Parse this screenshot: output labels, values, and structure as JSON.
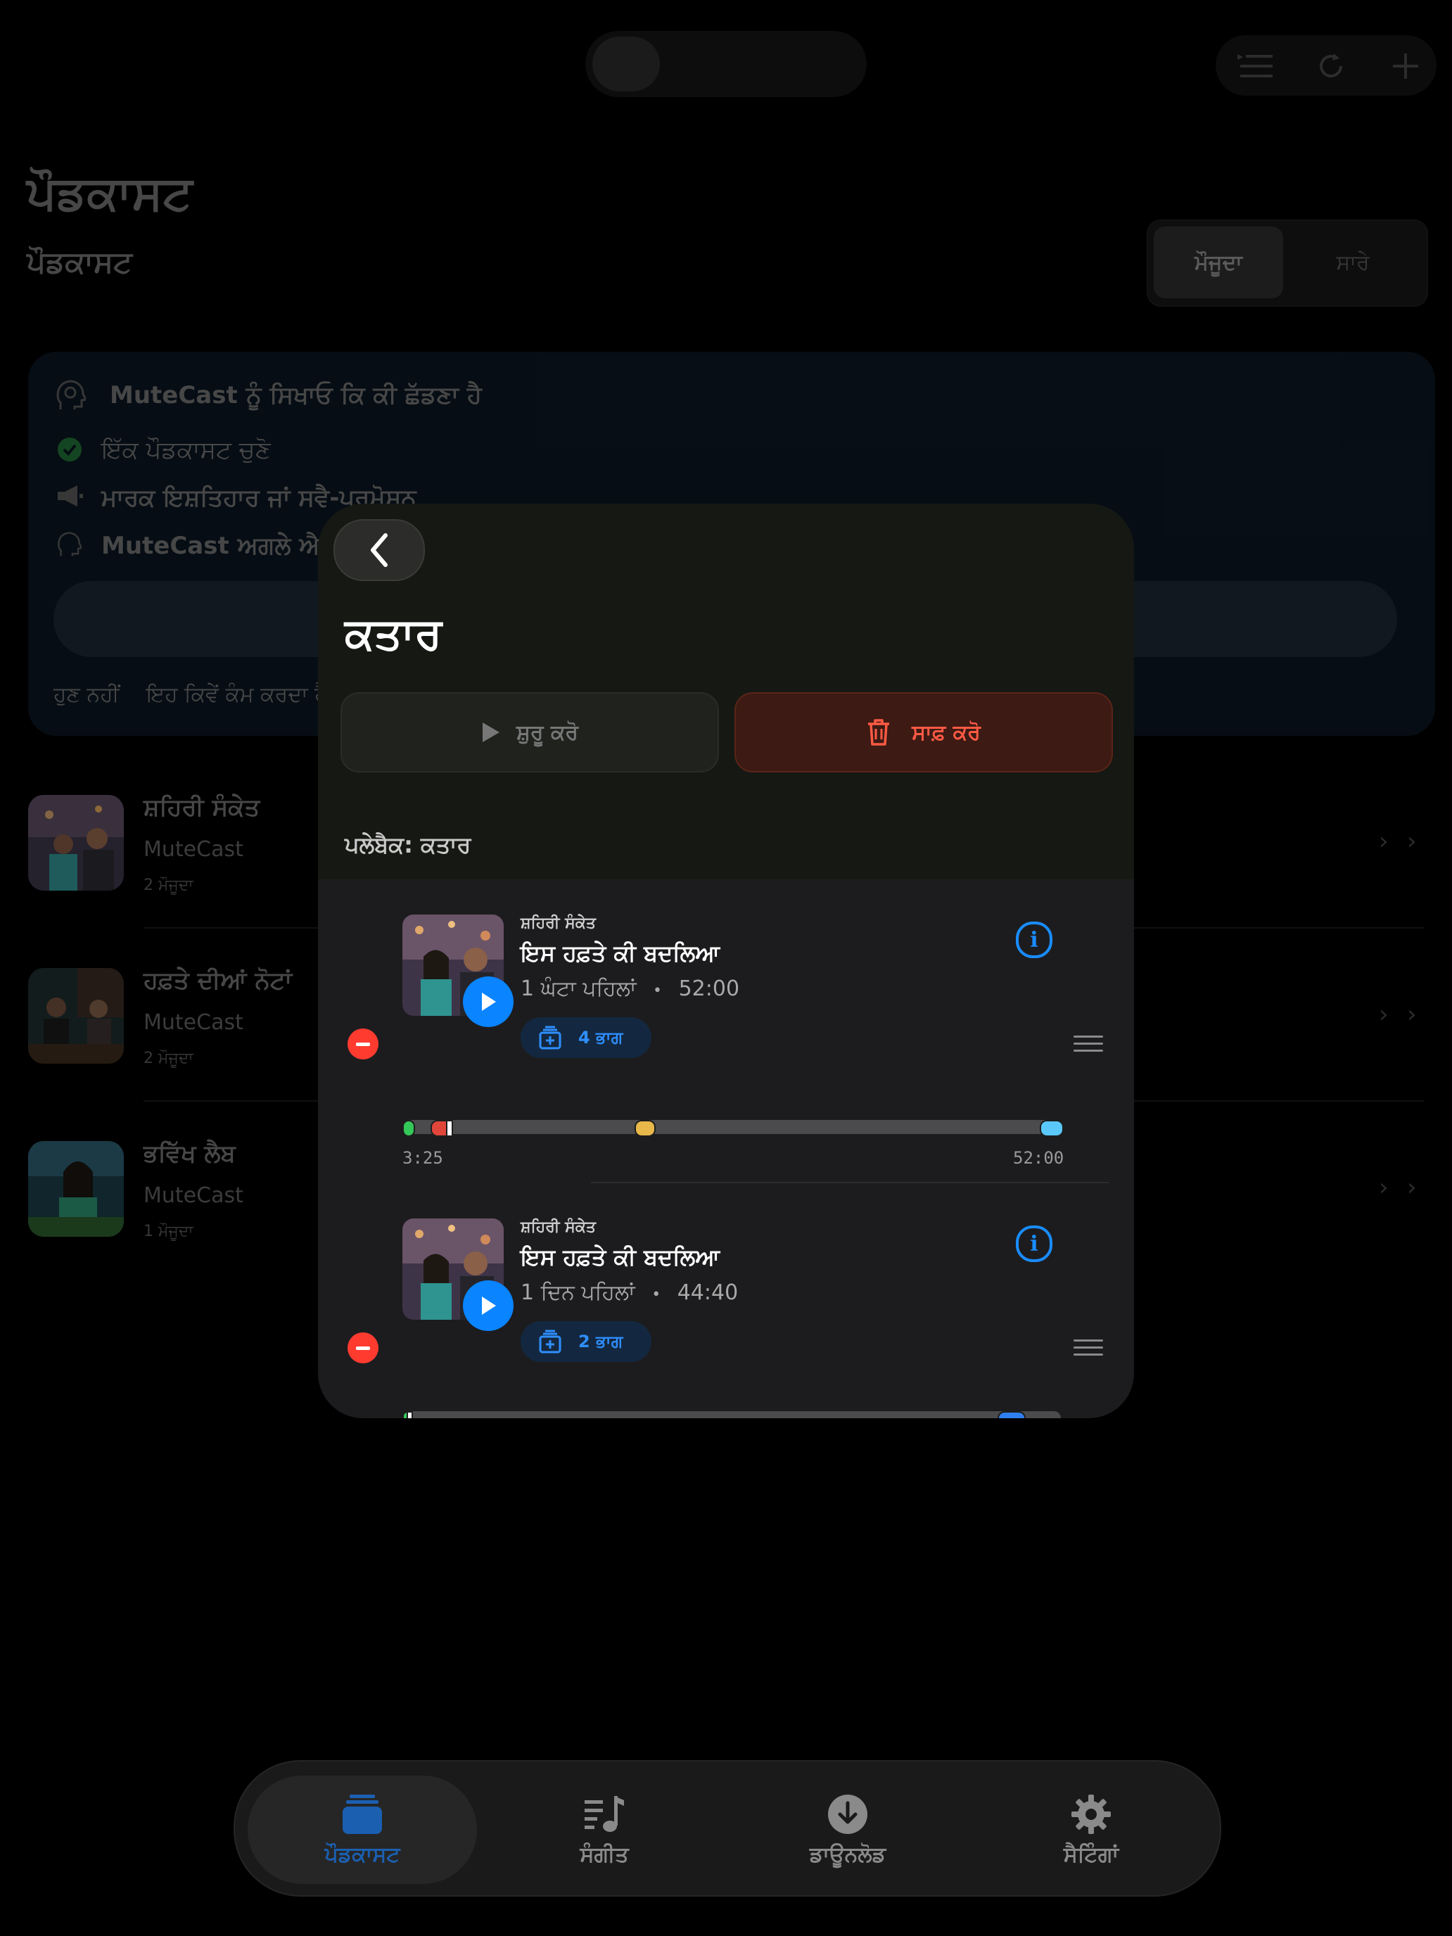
{
  "background": {
    "header": {
      "title": "ਪੌਡਕਾਸਟ",
      "subtitle": "ਪੌਡਕਾਸਟ"
    },
    "segmented": {
      "current_label": "ਮੌਜੂਦਾ",
      "all_label": "ਸਾਰੇ"
    },
    "onboarding_card": {
      "title": "MuteCast ਨੂੰ ਸਿਖਾਓ ਕਿ ਕੀ ਛੱਡਣਾ ਹੈ",
      "step1": "ਇੱਕ ਪੌਡਕਾਸਟ ਚੁਣੋ",
      "step2": "ਮਾਰਕ ਇਸ਼ਤਿਹਾਰ ਜਾਂ ਸਵੈ-ਪ੍ਰਮੋਸ਼ਨ",
      "step3": "MuteCast ਅਗਲੇ ਐਪੀਸੋ",
      "not_now": "ਹੁਣ ਨਹੀਂ",
      "how_it_works": "ਇਹ ਕਿਵੇਂ ਕੰਮ ਕਰਦਾ ਹੈ"
    },
    "podcasts": [
      {
        "title": "ਸ਼ਹਿਰੀ ਸੰਕੇਤ",
        "author": "MuteCast",
        "count": "2 ਮੌਜੂਦਾ"
      },
      {
        "title": "ਹਫ਼ਤੇ ਦੀਆਂ ਨੋਟਾਂ",
        "author": "MuteCast",
        "count": "2 ਮੌਜੂਦਾ"
      },
      {
        "title": "ਭਵਿੱਖ ਲੈਬ",
        "author": "MuteCast",
        "count": "1 ਮੌਜੂਦਾ"
      }
    ]
  },
  "queue": {
    "title": "ਕਤਾਰ",
    "start_label": "ਸ਼ੁਰੂ ਕਰੋ",
    "clear_label": "ਸਾਫ਼ ਕਰੋ",
    "playback_label": "ਪਲੇਬੈਕ: ਕਤਾਰ",
    "episodes": [
      {
        "podcast": "ਸ਼ਹਿਰੀ ਸੰਕੇਤ",
        "title": "ਇਸ ਹਫ਼ਤੇ ਕੀ ਬਦਲਿਆ",
        "age": "1 ਘੰਟਾ ਪਹਿਲਾਂ",
        "duration": "52:00",
        "parts": "4 ਭਾਗ",
        "position": "3:25",
        "end": "52:00",
        "progress_fraction": 0.066
      },
      {
        "podcast": "ਸ਼ਹਿਰੀ ਸੰਕੇਤ",
        "title": "ਇਸ ਹਫ਼ਤੇ ਕੀ ਬਦਲਿਆ",
        "age": "1 ਦਿਨ ਪਹਿਲਾਂ",
        "duration": "44:40",
        "parts": "2 ਭਾਗ",
        "progress_fraction": 0.01
      }
    ]
  },
  "tabs": [
    {
      "label": "ਪੌਡਕਾਸਟ",
      "icon": "podcasts-stack-icon",
      "active": true
    },
    {
      "label": "ਸੰਗੀਤ",
      "icon": "music-list-icon",
      "active": false
    },
    {
      "label": "ਡਾਊਨਲੋਡ",
      "icon": "download-circle-icon",
      "active": false
    },
    {
      "label": "ਸੈਟਿੰਗਾਂ",
      "icon": "gear-icon",
      "active": false
    }
  ],
  "colors": {
    "accent": "#0a84ff",
    "destructive": "#ff3b30",
    "active_tab": "#1b5fb0"
  }
}
